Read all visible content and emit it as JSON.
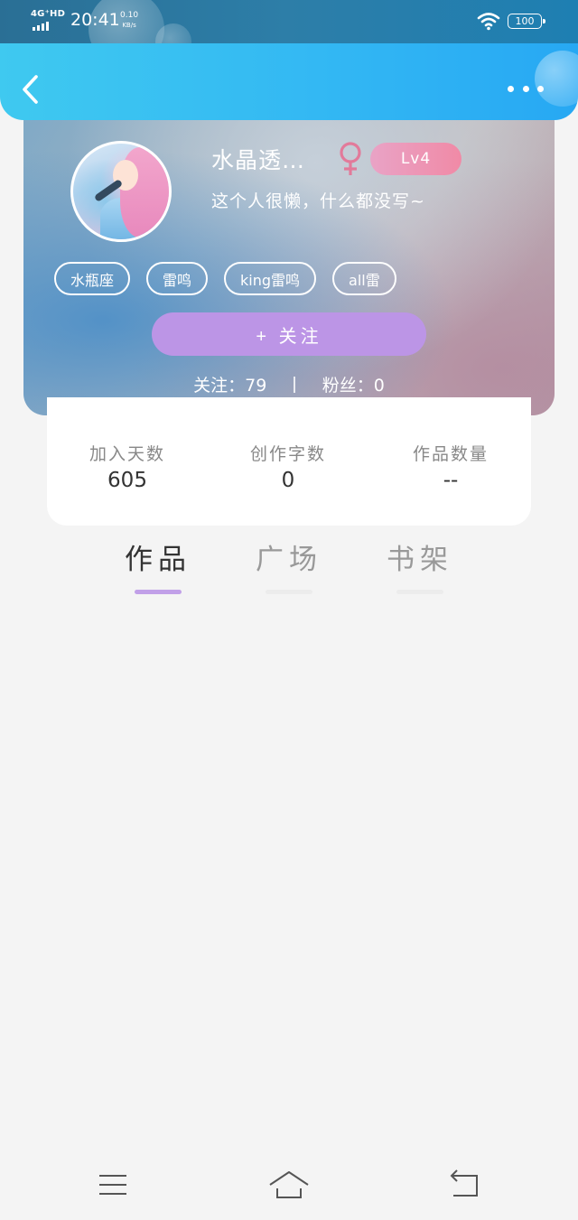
{
  "status_bar": {
    "network": "4G⁺HD",
    "time": "20:41",
    "speed_value": "0.10",
    "speed_unit": "KB/s",
    "battery": "100"
  },
  "icons": {
    "back": "chevron-left-icon",
    "more": "more-dots-icon",
    "gender": "female-symbol-icon",
    "wifi": "wifi-icon",
    "signal": "signal-icon",
    "battery": "battery-icon",
    "menu": "menu-icon",
    "home": "home-icon",
    "back_nav": "return-icon"
  },
  "profile": {
    "name": "水晶透…",
    "level": "Lv4",
    "bio": "这个人很懒，什么都没写~",
    "tags": [
      "水瓶座",
      "雷鸣",
      "king雷鸣",
      "all雷"
    ],
    "follow_label": "+ 关注",
    "following_text": "关注：79",
    "fans_text": "粉丝：0"
  },
  "stats": [
    {
      "label": "加入天数",
      "value": "605"
    },
    {
      "label": "创作字数",
      "value": "0"
    },
    {
      "label": "作品数量",
      "value": "--"
    }
  ],
  "tabs": [
    {
      "label": "作品",
      "active": true
    },
    {
      "label": "广场",
      "active": false
    },
    {
      "label": "书架",
      "active": false
    }
  ],
  "colors": {
    "header_gradient_start": "#3fc9f0",
    "header_gradient_end": "#27a8f3",
    "follow_button": "#bc95e6",
    "level_badge": "#f08aa6",
    "gender_icon": "#e27a9a",
    "tab_indicator_active": "#c1a0e8",
    "background": "#f4f4f4"
  }
}
